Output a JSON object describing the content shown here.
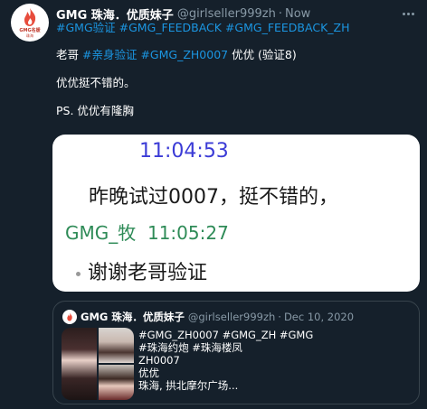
{
  "tweet": {
    "author_name": "GMG 珠海．优质妹子",
    "handle": "@girlseller999zh",
    "separator": "·",
    "time": "Now",
    "avatar": {
      "logo_text": "GMG名媛",
      "logo_sub": "珠海",
      "accent_color": "#e74c3c"
    },
    "line1": [
      {
        "text": "#GMG验证",
        "hashtag": true
      },
      {
        "text": " ",
        "hashtag": false
      },
      {
        "text": "#GMG_FEEDBACK",
        "hashtag": true
      },
      {
        "text": " ",
        "hashtag": false
      },
      {
        "text": "#GMG_FEEDBACK_ZH",
        "hashtag": true
      }
    ],
    "line2_prefix": "老哥 ",
    "line2_tag1": "#亲身验证",
    "line2_tag2": "#GMG_ZH0007",
    "line2_suffix": " 优优 (验证8)",
    "line3": "优优挺不错的。",
    "line4": "PS. 优优有隆胸"
  },
  "media": {
    "time1": "11:04:53",
    "message1": "昨晚试过0007，挺不错的，",
    "sender": "GMG_牧",
    "time2": "11:05:27",
    "message2": "谢谢老哥验证"
  },
  "quote": {
    "author_name": "GMG 珠海．优质妹子",
    "handle": "@girlseller999zh",
    "separator": "·",
    "date": "Dec 10, 2020",
    "lines": [
      "#GMG_ZH0007 #GMG_ZH #GMG",
      "#珠海约炮 #珠海楼凤",
      "ZH0007",
      "优优",
      "珠海, 拱北摩尔广场..."
    ]
  },
  "colors": {
    "background": "#15202b",
    "hashtag": "#1b95e0",
    "muted": "#8899a6",
    "chat_time": "#3b3bd6",
    "chat_sender": "#2e8b57"
  }
}
